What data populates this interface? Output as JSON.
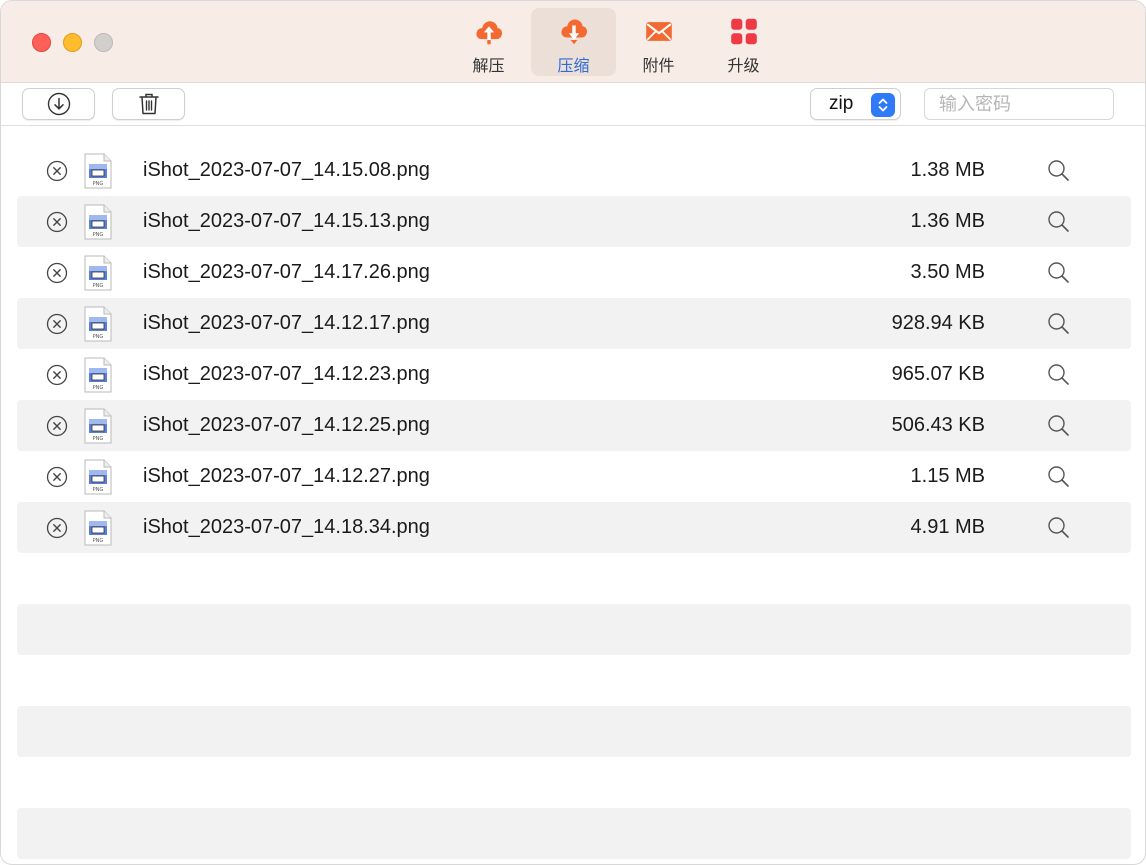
{
  "tabs": [
    {
      "label": "解压",
      "icon": "cloud-upload-icon",
      "active": false
    },
    {
      "label": "压缩",
      "icon": "cloud-download-icon",
      "active": true
    },
    {
      "label": "附件",
      "icon": "envelope-icon",
      "active": false
    },
    {
      "label": "升级",
      "icon": "grid-icon",
      "active": false
    }
  ],
  "toolbar": {
    "format": "zip",
    "password_placeholder": "输入密码"
  },
  "files": [
    {
      "name": "iShot_2023-07-07_14.15.08.png",
      "size": "1.38 MB"
    },
    {
      "name": "iShot_2023-07-07_14.15.13.png",
      "size": "1.36 MB"
    },
    {
      "name": "iShot_2023-07-07_14.17.26.png",
      "size": "3.50 MB"
    },
    {
      "name": "iShot_2023-07-07_14.12.17.png",
      "size": "928.94 KB"
    },
    {
      "name": "iShot_2023-07-07_14.12.23.png",
      "size": "965.07 KB"
    },
    {
      "name": "iShot_2023-07-07_14.12.25.png",
      "size": "506.43 KB"
    },
    {
      "name": "iShot_2023-07-07_14.12.27.png",
      "size": "1.15 MB"
    },
    {
      "name": "iShot_2023-07-07_14.18.34.png",
      "size": "4.91 MB"
    }
  ],
  "file_icon_label": "PNG",
  "colors": {
    "accent": "#2f7af6",
    "brand_orange": "#f26a32",
    "brand_red": "#ee3a45",
    "titlebar": "#f8ece6",
    "stripe": "#f2f2f2"
  }
}
